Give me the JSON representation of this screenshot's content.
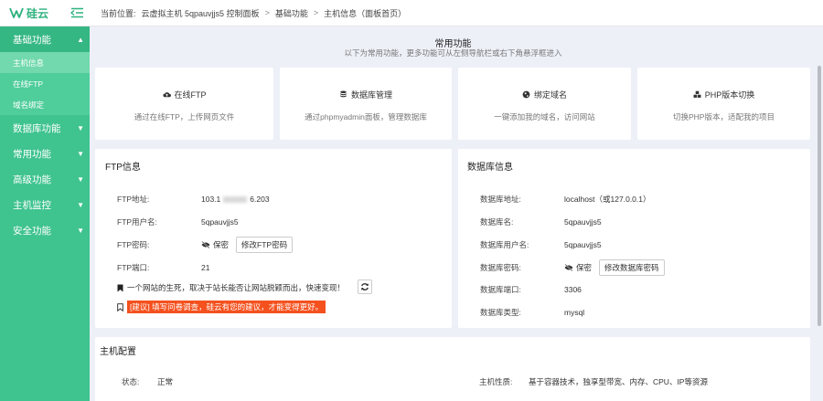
{
  "app": {
    "logo_text": "硅云"
  },
  "breadcrumb": {
    "prefix": "当前位置:",
    "items": [
      "云虚拟主机 5qpauvjjs5 控制面板",
      "基础功能",
      "主机信息（面板首页）"
    ],
    "sep": ">"
  },
  "sidebar": {
    "groups": [
      {
        "label": "基础功能",
        "caret": "▲"
      },
      {
        "label": "数据库功能",
        "caret": "▼"
      },
      {
        "label": "常用功能",
        "caret": "▼"
      },
      {
        "label": "高级功能",
        "caret": "▼"
      },
      {
        "label": "主机监控",
        "caret": "▼"
      },
      {
        "label": "安全功能",
        "caret": "▼"
      }
    ],
    "sub": [
      "主机信息",
      "在线FTP",
      "域名绑定"
    ]
  },
  "common": {
    "title": "常用功能",
    "subtitle": "以下为常用功能，更多功能可从左侧导航栏或右下角悬浮框进入",
    "cards": [
      {
        "title": "在线FTP",
        "desc": "通过在线FTP，上传网页文件",
        "icon": "cloud-upload-icon"
      },
      {
        "title": "数据库管理",
        "desc": "通过phpmyadmin面板，管理数据库",
        "icon": "database-icon"
      },
      {
        "title": "绑定域名",
        "desc": "一键添加我的域名，访问网站",
        "icon": "globe-icon"
      },
      {
        "title": "PHP版本切换",
        "desc": "切换PHP版本，适配我的项目",
        "icon": "cubes-icon"
      }
    ]
  },
  "ftp": {
    "title": "FTP信息",
    "addr_label": "FTP地址:",
    "addr_prefix": "103.1",
    "addr_suffix": "6.203",
    "user_label": "FTP用户名:",
    "user": "5qpauvjjs5",
    "pwd_label": "FTP密码:",
    "pwd_mask": "保密",
    "pwd_btn": "修改FTP密码",
    "port_label": "FTP端口:",
    "port": "21",
    "notice": "一个网站的生死，取决于站长能否让网站脱颖而出，快速变现！",
    "survey": "[建议] 填写问卷调查，硅云有您的建议，才能变得更好。"
  },
  "db": {
    "title": "数据库信息",
    "addr_label": "数据库地址:",
    "addr": "localhost（或127.0.0.1）",
    "name_label": "数据库名:",
    "name": "5qpauvjjs5",
    "user_label": "数据库用户名:",
    "user": "5qpauvjjs5",
    "pwd_label": "数据库密码:",
    "pwd_mask": "保密",
    "pwd_btn": "修改数据库密码",
    "port_label": "数据库端口:",
    "port": "3306",
    "type_label": "数据库类型:",
    "type": "mysql"
  },
  "host": {
    "title": "主机配置",
    "status_label": "状态:",
    "status": "正常",
    "nature_label": "主机性质:",
    "nature": "基于容器技术，独享型带宽、内存、CPU、IP等资源"
  }
}
